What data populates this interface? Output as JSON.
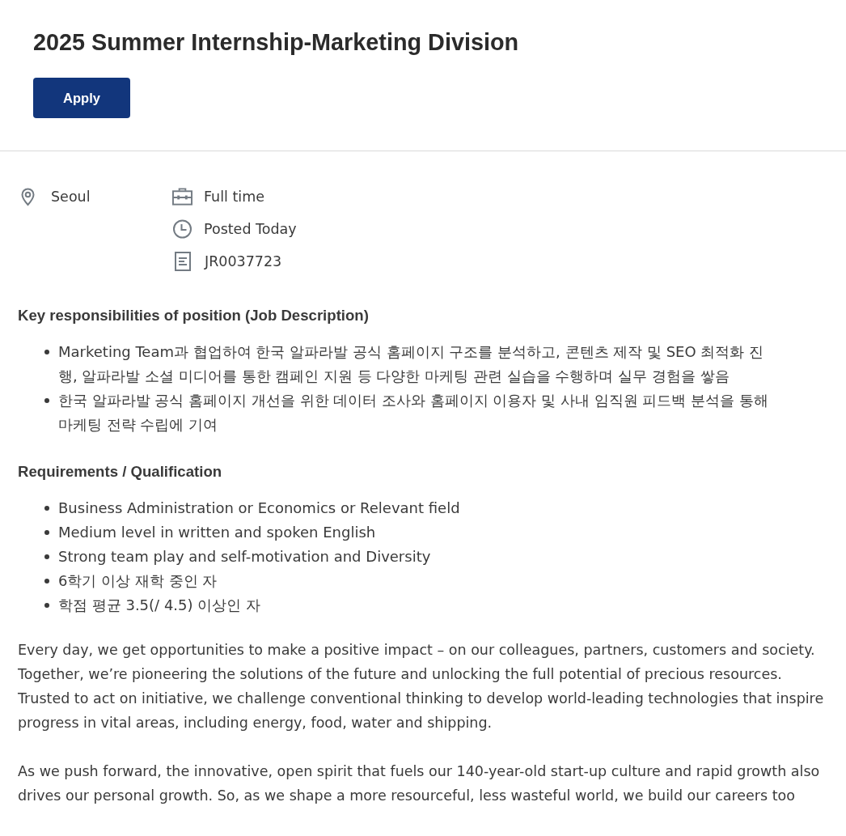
{
  "job": {
    "title": "2025 Summer Internship-Marketing Division",
    "apply_button": "Apply"
  },
  "details": {
    "location": {
      "kind": "pin",
      "text": "Seoul"
    },
    "info": [
      {
        "kind": "briefcase",
        "text": "Full time"
      },
      {
        "kind": "clock",
        "text": "Posted Today"
      },
      {
        "kind": "document",
        "text": "JR0037723"
      }
    ]
  },
  "sections": [
    {
      "heading": "Key responsibilities of position (Job Description)",
      "items": [
        "Marketing Team과 협업하여 한국 알파라발 공식 홈페이지 구조를 분석하고, 콘텐츠 제작 및 SEO 최적화 진행, 알파라발 소셜 미디어를 통한 캠페인 지원 등 다양한 마케팅 관련 실습을 수행하며 실무 경험을 쌓음",
        "한국 알파라발 공식 홈페이지 개선을 위한 데이터 조사와 홈페이지 이용자 및 사내 임직원 피드백 분석을 통해 마케팅 전략 수립에 기여"
      ]
    },
    {
      "heading": "Requirements / Qualification",
      "items": [
        "Business Administration or Economics or Relevant field",
        "Medium level in written and spoken English",
        "Strong team play and self-motivation and Diversity",
        "6학기 이상 재학 중인 자",
        "학점 평균 3.5(/ 4.5) 이상인 자"
      ]
    }
  ],
  "paragraphs": [
    "Every day, we get opportunities to make a positive impact – on our colleagues, partners, customers and society. Together, we’re pioneering the solutions of the future and unlocking the full potential of precious resources. Trusted to act on initiative, we challenge conventional thinking to develop world-leading technologies that inspire progress in vital areas, including energy, food, water and shipping.",
    "As we push forward, the innovative, open spirit that fuels our 140-year-old start-up culture and rapid growth also drives our personal growth. So, as we shape a more resourceful, less wasteful world, we build our careers too"
  ]
}
